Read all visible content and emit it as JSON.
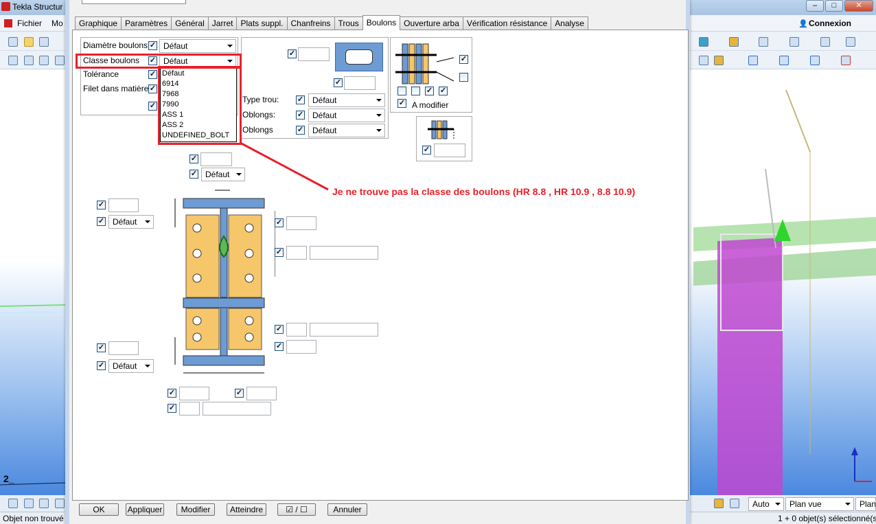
{
  "app": {
    "title": "Tekla Structur",
    "menu": [
      "Fichier",
      "Mo"
    ],
    "connexion": "Connexion",
    "status_left": "Objet non trouvé",
    "status_right": "1 + 0 objet(s) sélectionné(s)",
    "viewport_label": "2_",
    "bottom_auto": "Auto",
    "bottom_plan": "Plan vue",
    "bottom_plans": "Plans"
  },
  "dialog": {
    "tabs": [
      "Graphique",
      "Paramètres",
      "Général",
      "Jarret",
      "Plats suppl.",
      "Chanfreins",
      "Trous",
      "Boulons",
      "Ouverture arba",
      "Vérification résistance",
      "Analyse"
    ],
    "active_tab": "Boulons",
    "fields": {
      "diametre_label": "Diamètre boulons",
      "diametre_value": "Défaut",
      "classe_label": "Classe boulons",
      "classe_value": "Défaut",
      "tolerance_label": "Tolérance",
      "filet_label": "Filet dans matière"
    },
    "dropdown_options": [
      "Défaut",
      "6914",
      "7968",
      "7990",
      "ASS 1",
      "ASS 2",
      "UNDEFINED_BOLT"
    ],
    "hole": {
      "type_trou_label": "Type trou:",
      "type_trou_value": "Défaut",
      "oblongs1_label": "Oblongs:",
      "oblongs1_value": "Défaut",
      "oblongs2_label": "Oblongs",
      "oblongs2_value": "Défaut"
    },
    "a_modifier": "A modifier",
    "defaut": "Défaut",
    "annotation": "Je ne trouve pas la classe des boulons (HR 8.8 , HR 10.9 , 8.8 10.9)",
    "buttons": {
      "ok": "OK",
      "appliquer": "Appliquer",
      "modifier": "Modifier",
      "atteindre": "Atteindre",
      "toggle": "☑ / ☐",
      "annuler": "Annuler"
    }
  },
  "colors": {
    "accent_red": "#e8202a",
    "plate_blue": "#6d9bd3",
    "plate_orange": "#f6c66a",
    "viewport_blue": "#4a88df",
    "magenta": "#d13fd6"
  }
}
